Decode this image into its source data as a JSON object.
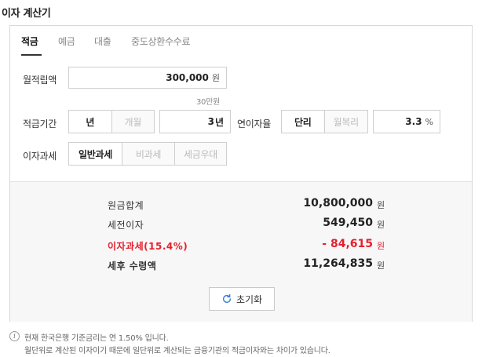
{
  "title": "이자 계산기",
  "tabs": [
    {
      "label": "적금",
      "active": true
    },
    {
      "label": "예금",
      "active": false
    },
    {
      "label": "대출",
      "active": false
    },
    {
      "label": "중도상환수수료",
      "active": false
    }
  ],
  "monthly_deposit": {
    "label": "월적립액",
    "value": "300,000",
    "unit": "원",
    "hint": "30만원"
  },
  "period": {
    "label": "적금기간",
    "options": [
      "년",
      "개월"
    ],
    "selected": "년",
    "value": "3",
    "unit": "년"
  },
  "rate": {
    "label": "연이자율",
    "options": [
      "단리",
      "월복리"
    ],
    "selected": "단리",
    "value": "3.3",
    "unit": "%"
  },
  "tax": {
    "label": "이자과세",
    "options": [
      "일반과세",
      "비과세",
      "세금우대"
    ],
    "selected": "일반과세"
  },
  "results": [
    {
      "label": "원금합계",
      "value": "10,800,000",
      "unit": "원",
      "highlight": false
    },
    {
      "label": "세전이자",
      "value": "549,450",
      "unit": "원",
      "highlight": false
    },
    {
      "label": "이자과세(15.4%)",
      "value": "- 84,615",
      "unit": "원",
      "highlight": true
    },
    {
      "label": "세후 수령액",
      "value": "11,264,835",
      "unit": "원",
      "highlight": false
    }
  ],
  "reset_label": "초기화",
  "notice": [
    "현재 한국은행 기준금리는 연 1.50% 입니다.",
    "월단위로 계산된 이자이기 때문에 일단위로 계산되는 금융기관의 적금이자와는 차이가 있습니다."
  ],
  "colors": {
    "accent_red": "#e5202e"
  },
  "icons": {
    "reset": "refresh-icon",
    "notice": "info-icon"
  }
}
